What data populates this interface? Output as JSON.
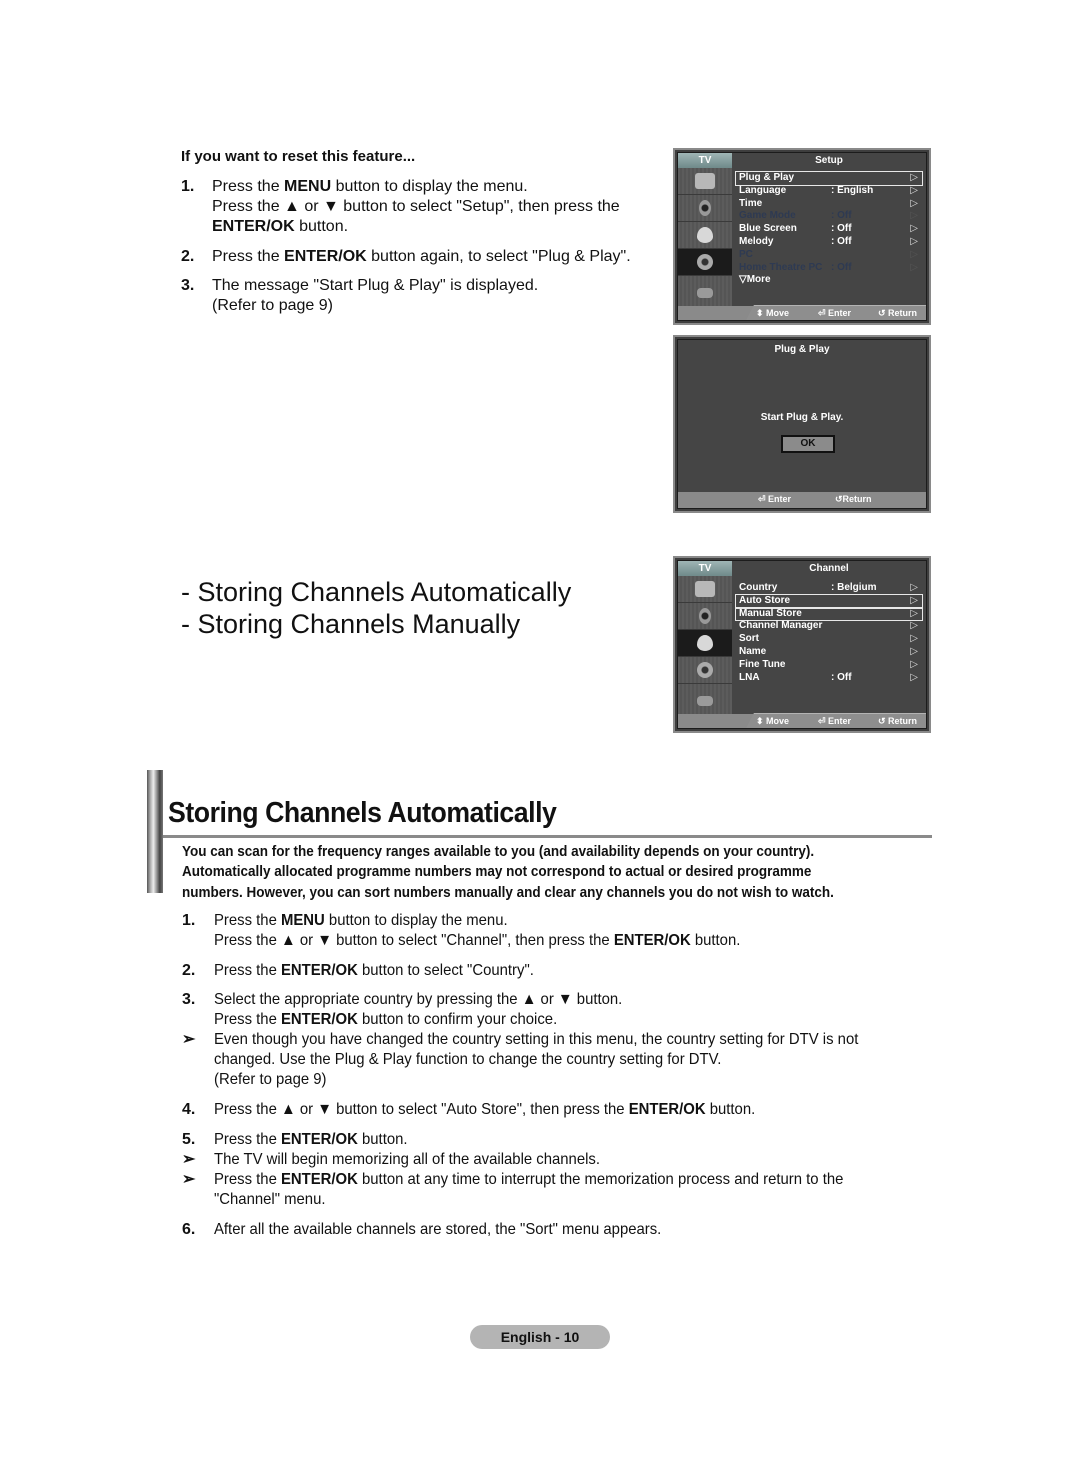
{
  "reset_section": {
    "title": "If you want to reset this feature...",
    "steps": [
      {
        "num": "1.",
        "lines": [
          {
            "parts": [
              {
                "t": "Press the "
              },
              {
                "t": "MENU",
                "b": true
              },
              {
                "t": " button to display the menu."
              }
            ]
          },
          {
            "parts": [
              {
                "t": "Press the ▲ or ▼ button to select \"Setup\", then press the"
              }
            ]
          },
          {
            "parts": [
              {
                "t": "ENTER/OK",
                "b": true
              },
              {
                "t": " button."
              }
            ]
          }
        ]
      },
      {
        "num": "2.",
        "lines": [
          {
            "parts": [
              {
                "t": "Press the "
              },
              {
                "t": "ENTER/OK",
                "b": true
              },
              {
                "t": " button again, to select \"Plug & Play\"."
              }
            ]
          }
        ]
      },
      {
        "num": "3.",
        "lines": [
          {
            "parts": [
              {
                "t": "The message \"Start Plug & Play\" is displayed."
              }
            ]
          },
          {
            "parts": [
              {
                "t": "(Refer to page 9)"
              }
            ]
          }
        ]
      }
    ]
  },
  "related_links": [
    "- Storing Channels Automatically",
    "- Storing Channels Manually"
  ],
  "setup_menu": {
    "tab": "TV",
    "title": "Setup",
    "rows": [
      {
        "label": "Plug & Play",
        "value": "",
        "state": "selected"
      },
      {
        "label": "Language",
        "value": ": English",
        "state": "normal"
      },
      {
        "label": "Time",
        "value": "",
        "state": "normal"
      },
      {
        "label": "Game Mode",
        "value": ": Off",
        "state": "disabled"
      },
      {
        "label": "Blue Screen",
        "value": ": Off",
        "state": "normal"
      },
      {
        "label": "Melody",
        "value": ": Off",
        "state": "normal"
      },
      {
        "label": "PC",
        "value": "",
        "state": "disabled"
      },
      {
        "label": "Home Theatre PC",
        "value": ": Off",
        "state": "disabled"
      },
      {
        "label": "▽More",
        "value": "",
        "state": "more"
      }
    ],
    "footer": {
      "move": "Move",
      "enter": "Enter",
      "return": "Return"
    }
  },
  "plug_play_dialog": {
    "title": "Plug & Play",
    "message": "Start Plug & Play.",
    "ok_label": "OK",
    "footer": {
      "enter": "Enter",
      "return": "Return"
    }
  },
  "channel_menu": {
    "tab": "TV",
    "title": "Channel",
    "rows": [
      {
        "label": "Country",
        "value": ": Belgium",
        "state": "normal"
      },
      {
        "label": "Auto Store",
        "value": "",
        "state": "selected"
      },
      {
        "label": "Manual Store",
        "value": "",
        "state": "selected"
      },
      {
        "label": "Channel Manager",
        "value": "",
        "state": "normal"
      },
      {
        "label": "Sort",
        "value": "",
        "state": "normal"
      },
      {
        "label": "Name",
        "value": "",
        "state": "normal"
      },
      {
        "label": "Fine Tune",
        "value": "",
        "state": "normal"
      },
      {
        "label": "LNA",
        "value": ": Off",
        "state": "normal"
      }
    ],
    "footer": {
      "move": "Move",
      "enter": "Enter",
      "return": "Return"
    }
  },
  "section": {
    "heading": "Storing Channels Automatically",
    "intro": [
      "You can scan for the frequency ranges available to you (and availability depends on your country).",
      "Automatically allocated programme numbers may not correspond to actual or desired programme",
      "numbers. However, you can sort numbers manually and clear any channels you do not wish to watch."
    ],
    "steps": [
      {
        "num": "1.",
        "parts": [
          {
            "t": "Press the "
          },
          {
            "t": "MENU",
            "b": true
          },
          {
            "t": " button to display the menu."
          }
        ]
      },
      {
        "num": "",
        "parts": [
          {
            "t": "Press the ▲ or ▼ button to select \"Channel\", then press the "
          },
          {
            "t": "ENTER/OK",
            "b": true
          },
          {
            "t": " button."
          }
        ]
      },
      {
        "num": "2.",
        "parts": [
          {
            "t": "Press the "
          },
          {
            "t": "ENTER/OK",
            "b": true
          },
          {
            "t": " button to select \"Country\"."
          }
        ]
      },
      {
        "num": "3.",
        "parts": [
          {
            "t": "Select the appropriate country by pressing the ▲ or ▼ button."
          }
        ]
      },
      {
        "num": "",
        "parts": [
          {
            "t": "Press the "
          },
          {
            "t": "ENTER/OK",
            "b": true
          },
          {
            "t": " button to confirm your choice."
          }
        ]
      },
      {
        "num": "➢",
        "parts": [
          {
            "t": "Even though you have changed the country setting in this menu, the country setting for DTV is not"
          }
        ]
      },
      {
        "num": "",
        "parts": [
          {
            "t": "changed. Use the Plug & Play function to change the country setting for DTV."
          }
        ]
      },
      {
        "num": "",
        "parts": [
          {
            "t": "(Refer to page 9)"
          }
        ]
      },
      {
        "num": "4.",
        "parts": [
          {
            "t": "Press the ▲ or ▼ button to select \"Auto Store\", then press the "
          },
          {
            "t": "ENTER/OK",
            "b": true
          },
          {
            "t": " button."
          }
        ]
      },
      {
        "num": "5.",
        "parts": [
          {
            "t": "Press the "
          },
          {
            "t": "ENTER/OK",
            "b": true
          },
          {
            "t": " button."
          }
        ]
      },
      {
        "num": "➢",
        "parts": [
          {
            "t": "The TV will begin memorizing all of the available channels."
          }
        ]
      },
      {
        "num": "➢",
        "parts": [
          {
            "t": "Press the "
          },
          {
            "t": "ENTER/OK",
            "b": true
          },
          {
            "t": " button at any time to interrupt the memorization process and return to the"
          }
        ]
      },
      {
        "num": "",
        "parts": [
          {
            "t": "\"Channel\" menu."
          }
        ]
      },
      {
        "num": "6.",
        "parts": [
          {
            "t": "After all the available channels are stored, the \"Sort\" menu appears."
          }
        ]
      }
    ]
  },
  "page_label": "English - 10"
}
